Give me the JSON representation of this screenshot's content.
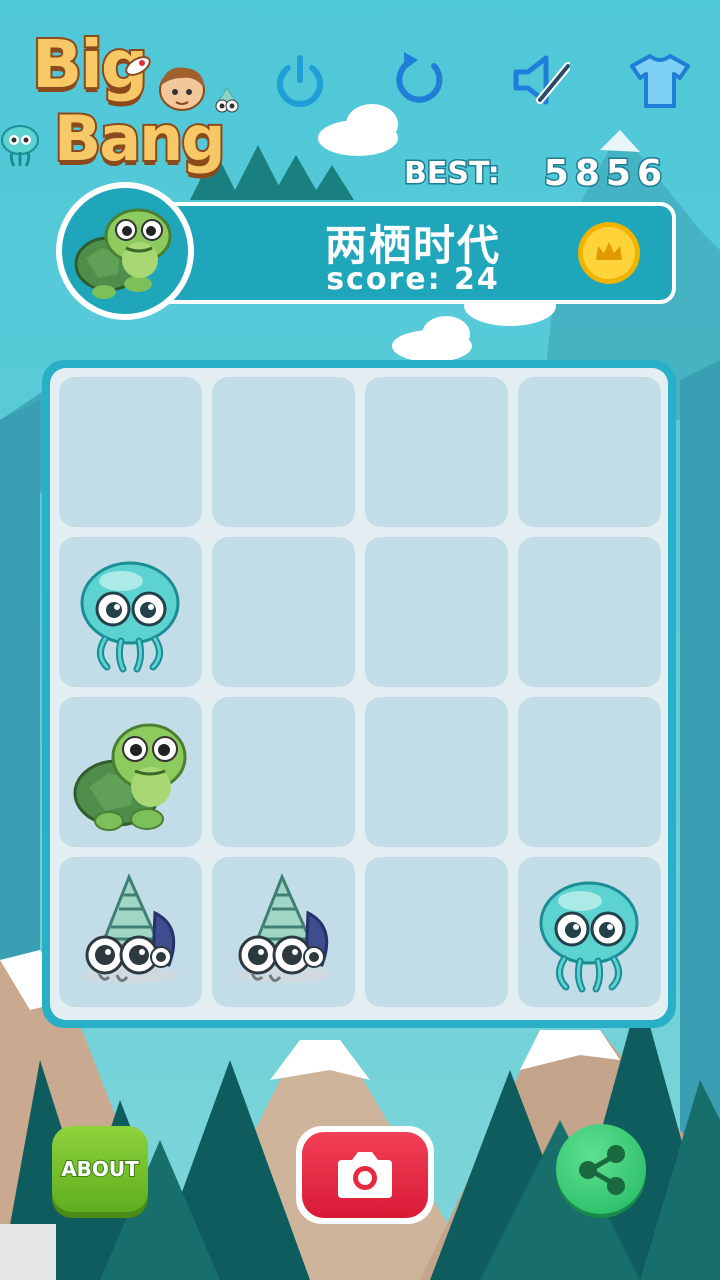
{
  "app": {
    "logo_line1": "Big",
    "logo_line2": "Bang"
  },
  "toolbar": {
    "icons": [
      "power-icon",
      "restart-icon",
      "sound-muted-icon",
      "shirt-icon"
    ]
  },
  "best": {
    "label": "BEST:",
    "value": "5856"
  },
  "status": {
    "era_title": "两栖时代",
    "score_text": "score: 24"
  },
  "board": {
    "rows": 4,
    "cols": 4,
    "tiles": [
      [
        "",
        "",
        "",
        ""
      ],
      [
        "jellyfish",
        "",
        "",
        ""
      ],
      [
        "turtle",
        "",
        "",
        ""
      ],
      [
        "hermit-crab",
        "hermit-crab",
        "",
        "jellyfish"
      ]
    ]
  },
  "footer": {
    "about_label": "ABOUT"
  },
  "colors": {
    "sky": "#5ccbd8",
    "panel": "#1fa6bb",
    "tile": "#c3dde8",
    "about": "#7cc62e",
    "camera": "#e8283f",
    "share": "#2ec46f"
  }
}
